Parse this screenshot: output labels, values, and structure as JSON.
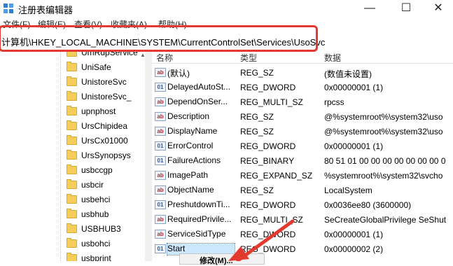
{
  "window": {
    "title": "注册表编辑器",
    "minimize": "—",
    "maximize": "☐",
    "close": "✕"
  },
  "menu": [
    "文件(F)",
    "编辑(E)",
    "查看(V)",
    "收藏夹(A)",
    "帮助(H)"
  ],
  "address": "计算机\\HKEY_LOCAL_MACHINE\\SYSTEM\\CurrentControlSet\\Services\\UsoSvc",
  "tree": {
    "items": [
      "UmRdpService",
      "UniSafe",
      "UnistoreSvc",
      "UnistoreSvc_",
      "upnphost",
      "UrsChipidea",
      "UrsCx01000",
      "UrsSynopsys",
      "usbccgp",
      "usbcir",
      "usbehci",
      "usbhub",
      "USBHUB3",
      "usbohci",
      "usbprint"
    ]
  },
  "list": {
    "headers": {
      "name": "名称",
      "type": "类型",
      "data": "数据"
    },
    "rows": [
      {
        "icon": "ab",
        "name": "(默认)",
        "type": "REG_SZ",
        "data": "(数值未设置)"
      },
      {
        "icon": "bin",
        "name": "DelayedAutoSt...",
        "type": "REG_DWORD",
        "data": "0x00000001 (1)"
      },
      {
        "icon": "ab",
        "name": "DependOnSer...",
        "type": "REG_MULTI_SZ",
        "data": "rpcss"
      },
      {
        "icon": "ab",
        "name": "Description",
        "type": "REG_SZ",
        "data": "@%systemroot%\\system32\\uso"
      },
      {
        "icon": "ab",
        "name": "DisplayName",
        "type": "REG_SZ",
        "data": "@%systemroot%\\system32\\uso"
      },
      {
        "icon": "bin",
        "name": "ErrorControl",
        "type": "REG_DWORD",
        "data": "0x00000001 (1)"
      },
      {
        "icon": "bin",
        "name": "FailureActions",
        "type": "REG_BINARY",
        "data": "80 51 01 00 00 00 00 00 00 00 0"
      },
      {
        "icon": "ab",
        "name": "ImagePath",
        "type": "REG_EXPAND_SZ",
        "data": "%systemroot%\\system32\\svcho"
      },
      {
        "icon": "ab",
        "name": "ObjectName",
        "type": "REG_SZ",
        "data": "LocalSystem"
      },
      {
        "icon": "bin",
        "name": "PreshutdownTi...",
        "type": "REG_DWORD",
        "data": "0x0036ee80 (3600000)"
      },
      {
        "icon": "ab",
        "name": "RequiredPrivile...",
        "type": "REG_MULTI_SZ",
        "data": "SeCreateGlobalPrivilege SeShut"
      },
      {
        "icon": "ab",
        "name": "ServiceSidType",
        "type": "REG_DWORD",
        "data": "0x00000001 (1)"
      },
      {
        "icon": "bin",
        "name": "Start",
        "type": "REG_DWORD",
        "data": "0x00000002 (2)",
        "selected": true
      }
    ]
  },
  "context_menu": {
    "first_item": "修改(M)..."
  },
  "colors": {
    "highlight_box": "#e23a2f",
    "selection": "#cce8ff",
    "folder": "#f5cd5a"
  }
}
